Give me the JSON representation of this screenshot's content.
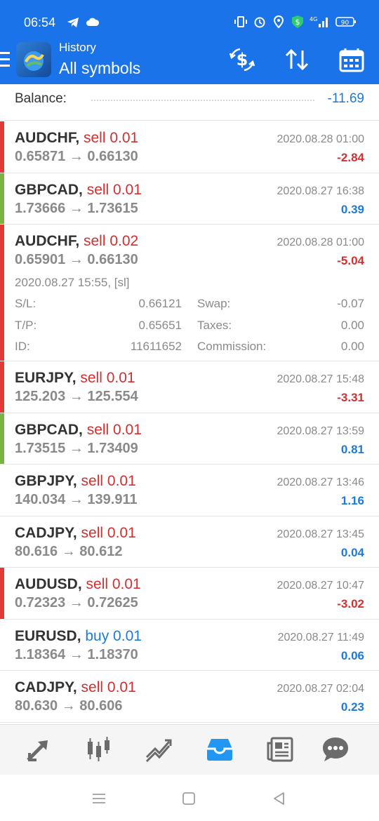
{
  "status_bar": {
    "time": "06:54",
    "battery": "90",
    "icons": [
      "telegram-icon",
      "cloud-icon",
      "vibrate-icon",
      "alarm-icon",
      "location-icon",
      "money-app-icon",
      "signal-4g-icon",
      "battery-icon"
    ]
  },
  "app_bar": {
    "title_small": "History",
    "title_big": "All symbols",
    "actions": [
      "currency-switch-icon",
      "sort-icon",
      "calendar-icon"
    ]
  },
  "balance": {
    "label": "Balance:",
    "value": "-11.69"
  },
  "trades": [
    {
      "symbol": "AUDCHF",
      "side": "sell 0.01",
      "open": "0.65871",
      "close": "0.66130",
      "date": "2020.08.28 01:00",
      "profit": "-2.84",
      "bar": "#e53935"
    },
    {
      "symbol": "GBPCAD",
      "side": "sell 0.01",
      "open": "1.73666",
      "close": "1.73615",
      "date": "2020.08.27 16:38",
      "profit": "0.39",
      "bar": "#7cb342"
    },
    {
      "symbol": "AUDCHF",
      "side": "sell 0.02",
      "open": "0.65901",
      "close": "0.66130",
      "date": "2020.08.28 01:00",
      "profit": "-5.04",
      "bar": "#e53935",
      "details": {
        "open_time": "2020.08.27 15:55, [sl]",
        "sl_label": "S/L:",
        "sl": "0.66121",
        "swap_label": "Swap:",
        "swap": "-0.07",
        "tp_label": "T/P:",
        "tp": "0.65651",
        "taxes_label": "Taxes:",
        "taxes": "0.00",
        "id_label": "ID:",
        "id": "11611652",
        "commission_label": "Commission:",
        "commission": "0.00"
      }
    },
    {
      "symbol": "EURJPY",
      "side": "sell 0.01",
      "open": "125.203",
      "close": "125.554",
      "date": "2020.08.27 15:48",
      "profit": "-3.31",
      "bar": "#e53935"
    },
    {
      "symbol": "GBPCAD",
      "side": "sell 0.01",
      "open": "1.73515",
      "close": "1.73409",
      "date": "2020.08.27 13:59",
      "profit": "0.81",
      "bar": "#7cb342"
    },
    {
      "symbol": "GBPJPY",
      "side": "sell 0.01",
      "open": "140.034",
      "close": "139.911",
      "date": "2020.08.27 13:46",
      "profit": "1.16",
      "bar": ""
    },
    {
      "symbol": "CADJPY",
      "side": "sell 0.01",
      "open": "80.616",
      "close": "80.612",
      "date": "2020.08.27 13:45",
      "profit": "0.04",
      "bar": ""
    },
    {
      "symbol": "AUDUSD",
      "side": "sell 0.01",
      "open": "0.72323",
      "close": "0.72625",
      "date": "2020.08.27 10:47",
      "profit": "-3.02",
      "bar": "#e53935"
    },
    {
      "symbol": "EURUSD",
      "side": "buy 0.01",
      "open": "1.18364",
      "close": "1.18370",
      "date": "2020.08.27 11:49",
      "profit": "0.06",
      "bar": ""
    },
    {
      "symbol": "CADJPY",
      "side": "sell 0.01",
      "open": "80.630",
      "close": "80.606",
      "date": "2020.08.27 02:04",
      "profit": "0.23",
      "bar": ""
    }
  ],
  "bottom_nav": [
    "quotes-icon",
    "chart-icon",
    "trade-icon",
    "history-icon",
    "news-icon",
    "chat-icon"
  ],
  "system_nav": [
    "recents-icon",
    "home-icon",
    "back-icon"
  ],
  "colors": {
    "primary": "#1a73e8",
    "sell": "#d32f2f",
    "buy": "#1e7ad4",
    "positive": "#1e7ad4",
    "negative": "#d32f2f",
    "active_nav": "#2196f3"
  }
}
